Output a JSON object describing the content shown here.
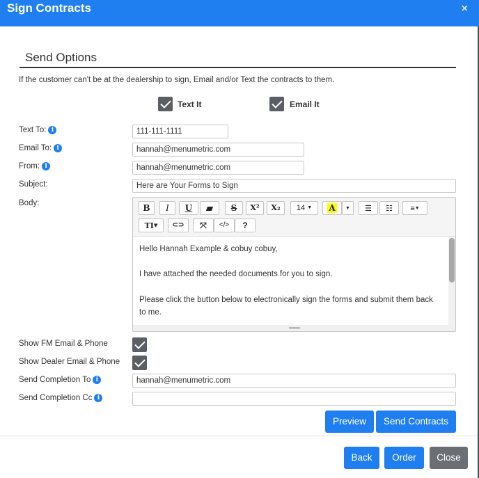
{
  "header": {
    "title": "Sign Contracts",
    "close_glyph": "×"
  },
  "section": {
    "title": "Send Options",
    "intro": "If the customer can't be at the dealership to sign, Email and/or Text the contracts to them."
  },
  "send_methods": {
    "text_it": {
      "label": "Text It",
      "checked": true
    },
    "email_it": {
      "label": "Email It",
      "checked": true
    }
  },
  "form": {
    "text_to": {
      "label": "Text To:",
      "value": "111-111-1111"
    },
    "email_to": {
      "label": "Email To:",
      "value": "hannah@menumetric.com"
    },
    "from": {
      "label": "From:",
      "value": "hannah@menumetric.com"
    },
    "subject": {
      "label": "Subject:",
      "value": "Here are Your Forms to Sign"
    },
    "body_label": "Body:"
  },
  "editor": {
    "toolbar": {
      "bold": "B",
      "italic": "I",
      "underline": "U",
      "strike": "S",
      "superscript": "X²",
      "subscript": "X₂",
      "font_size": "14",
      "color": "A",
      "link": "⊂⊃",
      "code": "</>",
      "help": "?",
      "style": "TI"
    },
    "highlight_color": "#ffff00",
    "body": {
      "line1": "Hello Hannah Example & cobuy cobuy,",
      "line2": "I have attached the needed documents for you to sign.",
      "line3": "Please click the button below to electronically sign the forms and submit them back to me."
    }
  },
  "options": {
    "show_fm": {
      "label": "Show FM Email & Phone",
      "checked": true
    },
    "show_dealer": {
      "label": "Show Dealer Email & Phone",
      "checked": true
    },
    "completion_to": {
      "label": "Send Completion To",
      "value": "hannah@menumetric.com"
    },
    "completion_cc": {
      "label": "Send Completion Cc",
      "value": ""
    }
  },
  "actions": {
    "preview": "Preview",
    "send": "Send Contracts"
  },
  "footer": {
    "back": "Back",
    "order": "Order",
    "close": "Close"
  },
  "colors": {
    "primary": "#1f7ef0",
    "secondary": "#6b6f73",
    "checkbox": "#5b5f63"
  }
}
